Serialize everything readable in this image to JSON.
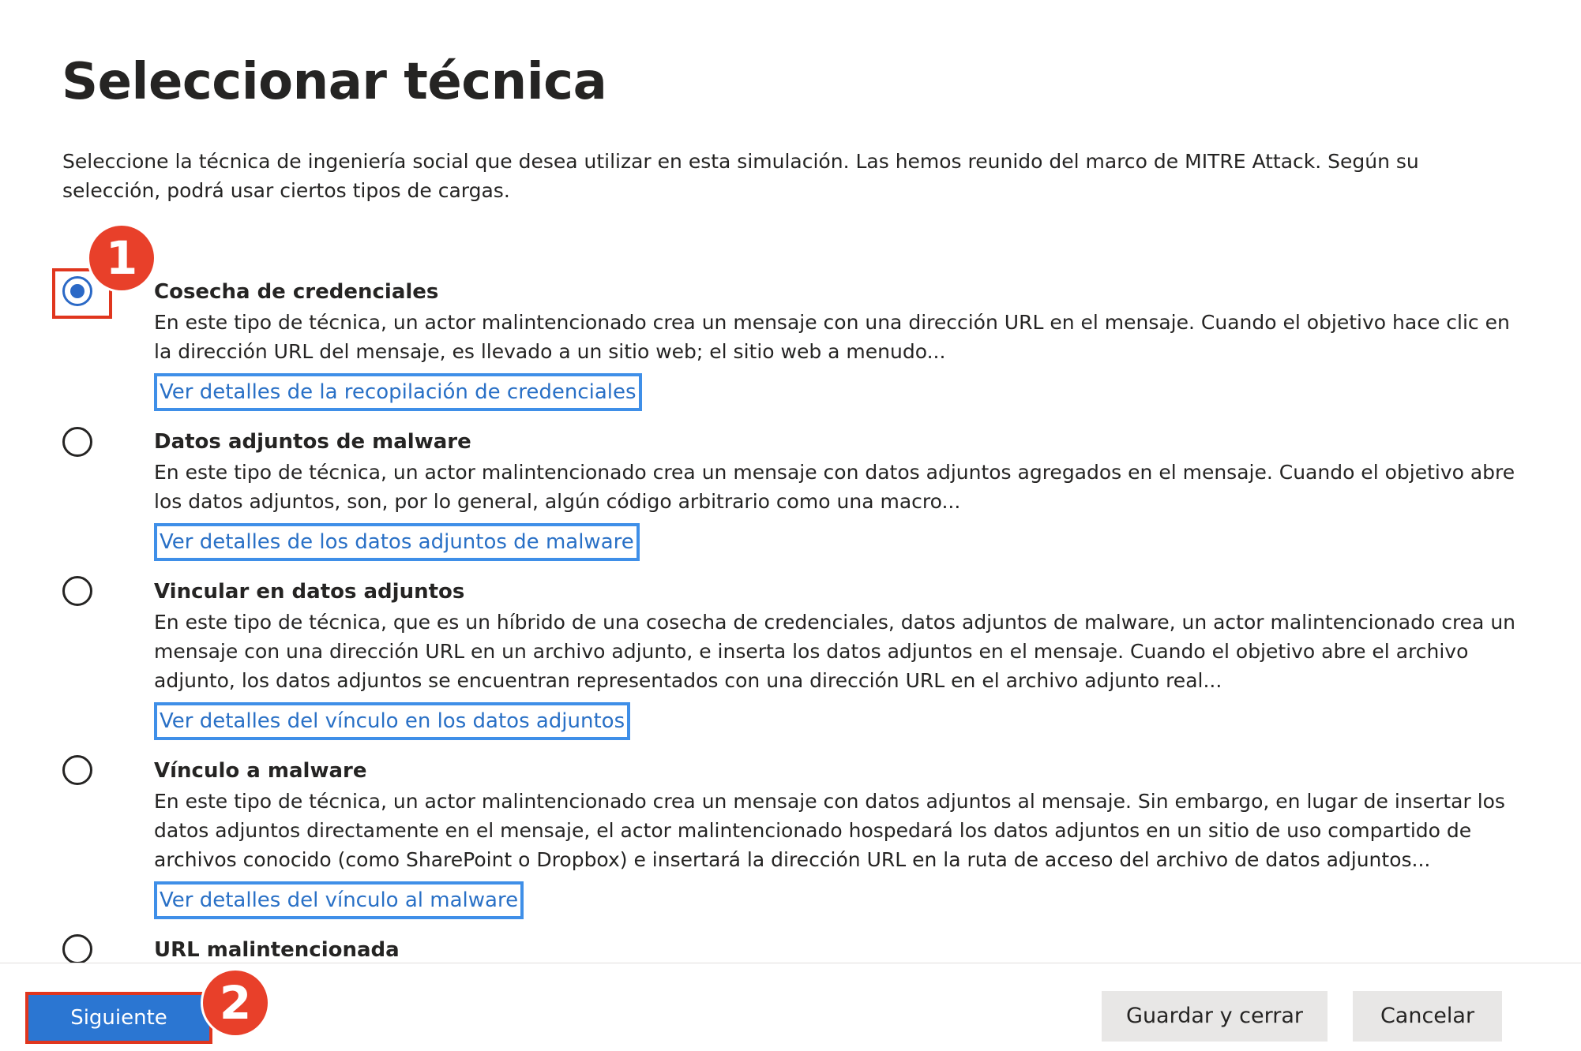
{
  "page": {
    "title": "Seleccionar técnica",
    "intro": "Seleccione la técnica de ingeniería social que desea utilizar en esta simulación. Las hemos reunido del marco de MITRE Attack. Según su selección, podrá usar ciertos tipos de cargas."
  },
  "options": [
    {
      "title": "Cosecha de credenciales",
      "description": "En este tipo de técnica, un actor malintencionado crea un mensaje con una dirección URL en el mensaje. Cuando el objetivo hace clic en la dirección URL del mensaje, es llevado a un sitio web; el sitio web a menudo...",
      "link": "Ver detalles de la recopilación de credenciales",
      "selected": true
    },
    {
      "title": "Datos adjuntos de malware",
      "description": "En este tipo de técnica, un actor malintencionado crea un mensaje con datos adjuntos agregados en el mensaje. Cuando el objetivo abre los datos adjuntos, son, por lo general, algún código arbitrario como una macro...",
      "link": "Ver detalles de los datos adjuntos de malware",
      "selected": false
    },
    {
      "title": "Vincular en datos adjuntos",
      "description": "En este tipo de técnica, que es un híbrido de una cosecha de credenciales, datos adjuntos de malware, un actor malintencionado crea un mensaje con una dirección URL en un archivo adjunto, e inserta los datos adjuntos en el mensaje. Cuando el objetivo abre el archivo adjunto, los datos adjuntos se encuentran representados con una dirección URL en el archivo adjunto real...",
      "link": "Ver detalles del vínculo en los datos adjuntos",
      "selected": false
    },
    {
      "title": "Vínculo a malware",
      "description": "En este tipo de técnica, un actor malintencionado crea un mensaje con datos adjuntos al mensaje. Sin embargo, en lugar de insertar los datos adjuntos directamente en el mensaje, el actor malintencionado hospedará los datos adjuntos en un sitio de uso compartido de archivos conocido (como SharePoint o Dropbox) e insertará la dirección URL en la ruta de acceso del archivo de datos adjuntos...",
      "link": "Ver detalles del vínculo al malware",
      "selected": false
    },
    {
      "title": "URL malintencionada",
      "selected": false
    }
  ],
  "footer": {
    "next_label": "Siguiente",
    "save_close_label": "Guardar y cerrar",
    "cancel_label": "Cancelar"
  },
  "annotations": {
    "step1": "1",
    "step2": "2"
  },
  "colors": {
    "accent": "#2b69c6",
    "link": "#2970c6",
    "link_highlight": "#3f8fe8",
    "annotation_red": "#e0361e",
    "primary_button": "#2b76d2",
    "secondary_button": "#e8e7e6"
  }
}
